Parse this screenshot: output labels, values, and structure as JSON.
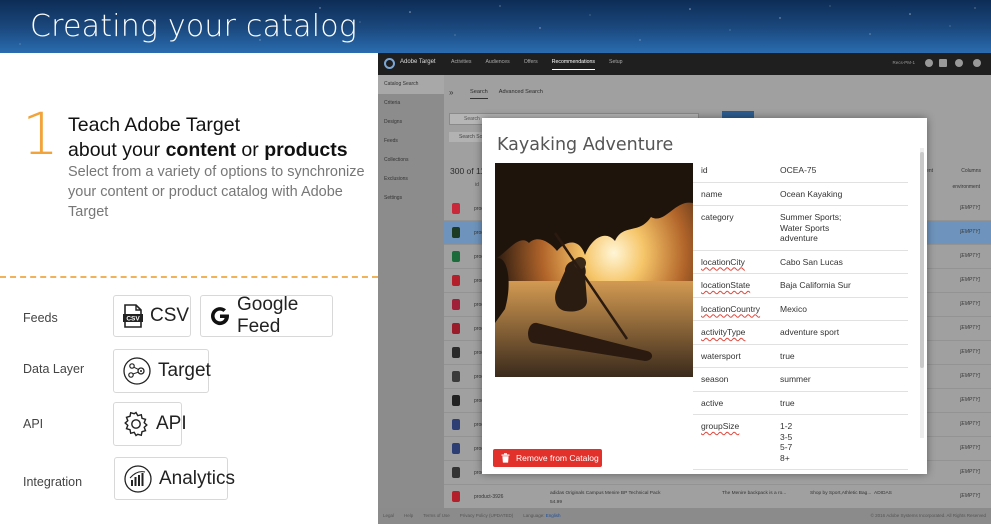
{
  "slide": {
    "title": "Creating your catalog",
    "step_number": "1",
    "heading_line1": "Teach Adobe Target",
    "heading_line2_pre": "about your ",
    "heading_content": "content",
    "heading_or": " or ",
    "heading_products": "products",
    "description": "Select from a variety of options to synchronize your content or product catalog with Adobe Target",
    "features": [
      {
        "label": "Feeds",
        "options": [
          "CSV",
          "Google Feed"
        ]
      },
      {
        "label": "Data Layer",
        "options": [
          "Target"
        ]
      },
      {
        "label": "API",
        "options": [
          "API"
        ]
      },
      {
        "label": "Integration",
        "options": [
          "Analytics"
        ]
      }
    ],
    "accent_color": "#f2a33a"
  },
  "app": {
    "brand": "Adobe Target",
    "nav": [
      "Activities",
      "Audiences",
      "Offers",
      "Recommendations",
      "Setup"
    ],
    "active_nav": "Recommendations",
    "user_label": "Recs-PM-1",
    "sidebar": [
      "Catalog Search",
      "Criteria",
      "Designs",
      "Feeds",
      "Collections",
      "Exclusions",
      "Settings"
    ],
    "tabs": [
      "Search",
      "Advanced Search"
    ],
    "search_placeholder": "Search",
    "chip_text": "Search So",
    "results_count": "300 of 112",
    "col_id": "id",
    "col_environment": "environment",
    "col_columns": "Columns",
    "empty_cell": "[EMPTY]",
    "row_code": "prod",
    "last_row": {
      "code": "product-3926",
      "name": "adidas Originals Campus Menire BP Technical Pack",
      "price": "54.99",
      "desc": "The Menire backpack is a ro...",
      "category": "Shop by Sport,Athletic Bag...",
      "brand": "ADIDAS"
    },
    "footer_links": [
      "Legal",
      "Help",
      "Terms of Use",
      "Privacy Policy (UPDATED)"
    ],
    "footer_language_label": "Language:",
    "footer_language": "English",
    "copyright": "© 2016 Adobe Systems Incorporated. All Rights Reserved"
  },
  "modal": {
    "title": "Kayaking Adventure",
    "attributes": [
      {
        "key": "id",
        "value": "OCEA-75",
        "squiggle": false
      },
      {
        "key": "name",
        "value": "Ocean Kayaking",
        "squiggle": false
      },
      {
        "key": "category",
        "value": "Summer Sports;\nWater Sports\nadventure",
        "squiggle": false
      },
      {
        "key": "locationCity",
        "value": "Cabo San Lucas",
        "squiggle": true
      },
      {
        "key": "locationState",
        "value": "Baja California Sur",
        "squiggle": true
      },
      {
        "key": "locationCountry",
        "value": "Mexico",
        "squiggle": true
      },
      {
        "key": "activityType",
        "value": "adventure sport",
        "squiggle": true
      },
      {
        "key": "watersport",
        "value": "true",
        "squiggle": false
      },
      {
        "key": "season",
        "value": "summer",
        "squiggle": false
      },
      {
        "key": "active",
        "value": "true",
        "squiggle": false
      },
      {
        "key": "groupSize",
        "value": "1-2\n3-5\n5-7\n8+",
        "squiggle": true
      }
    ],
    "remove_label": "Remove from Catalog",
    "remove_color": "#e2302b"
  }
}
